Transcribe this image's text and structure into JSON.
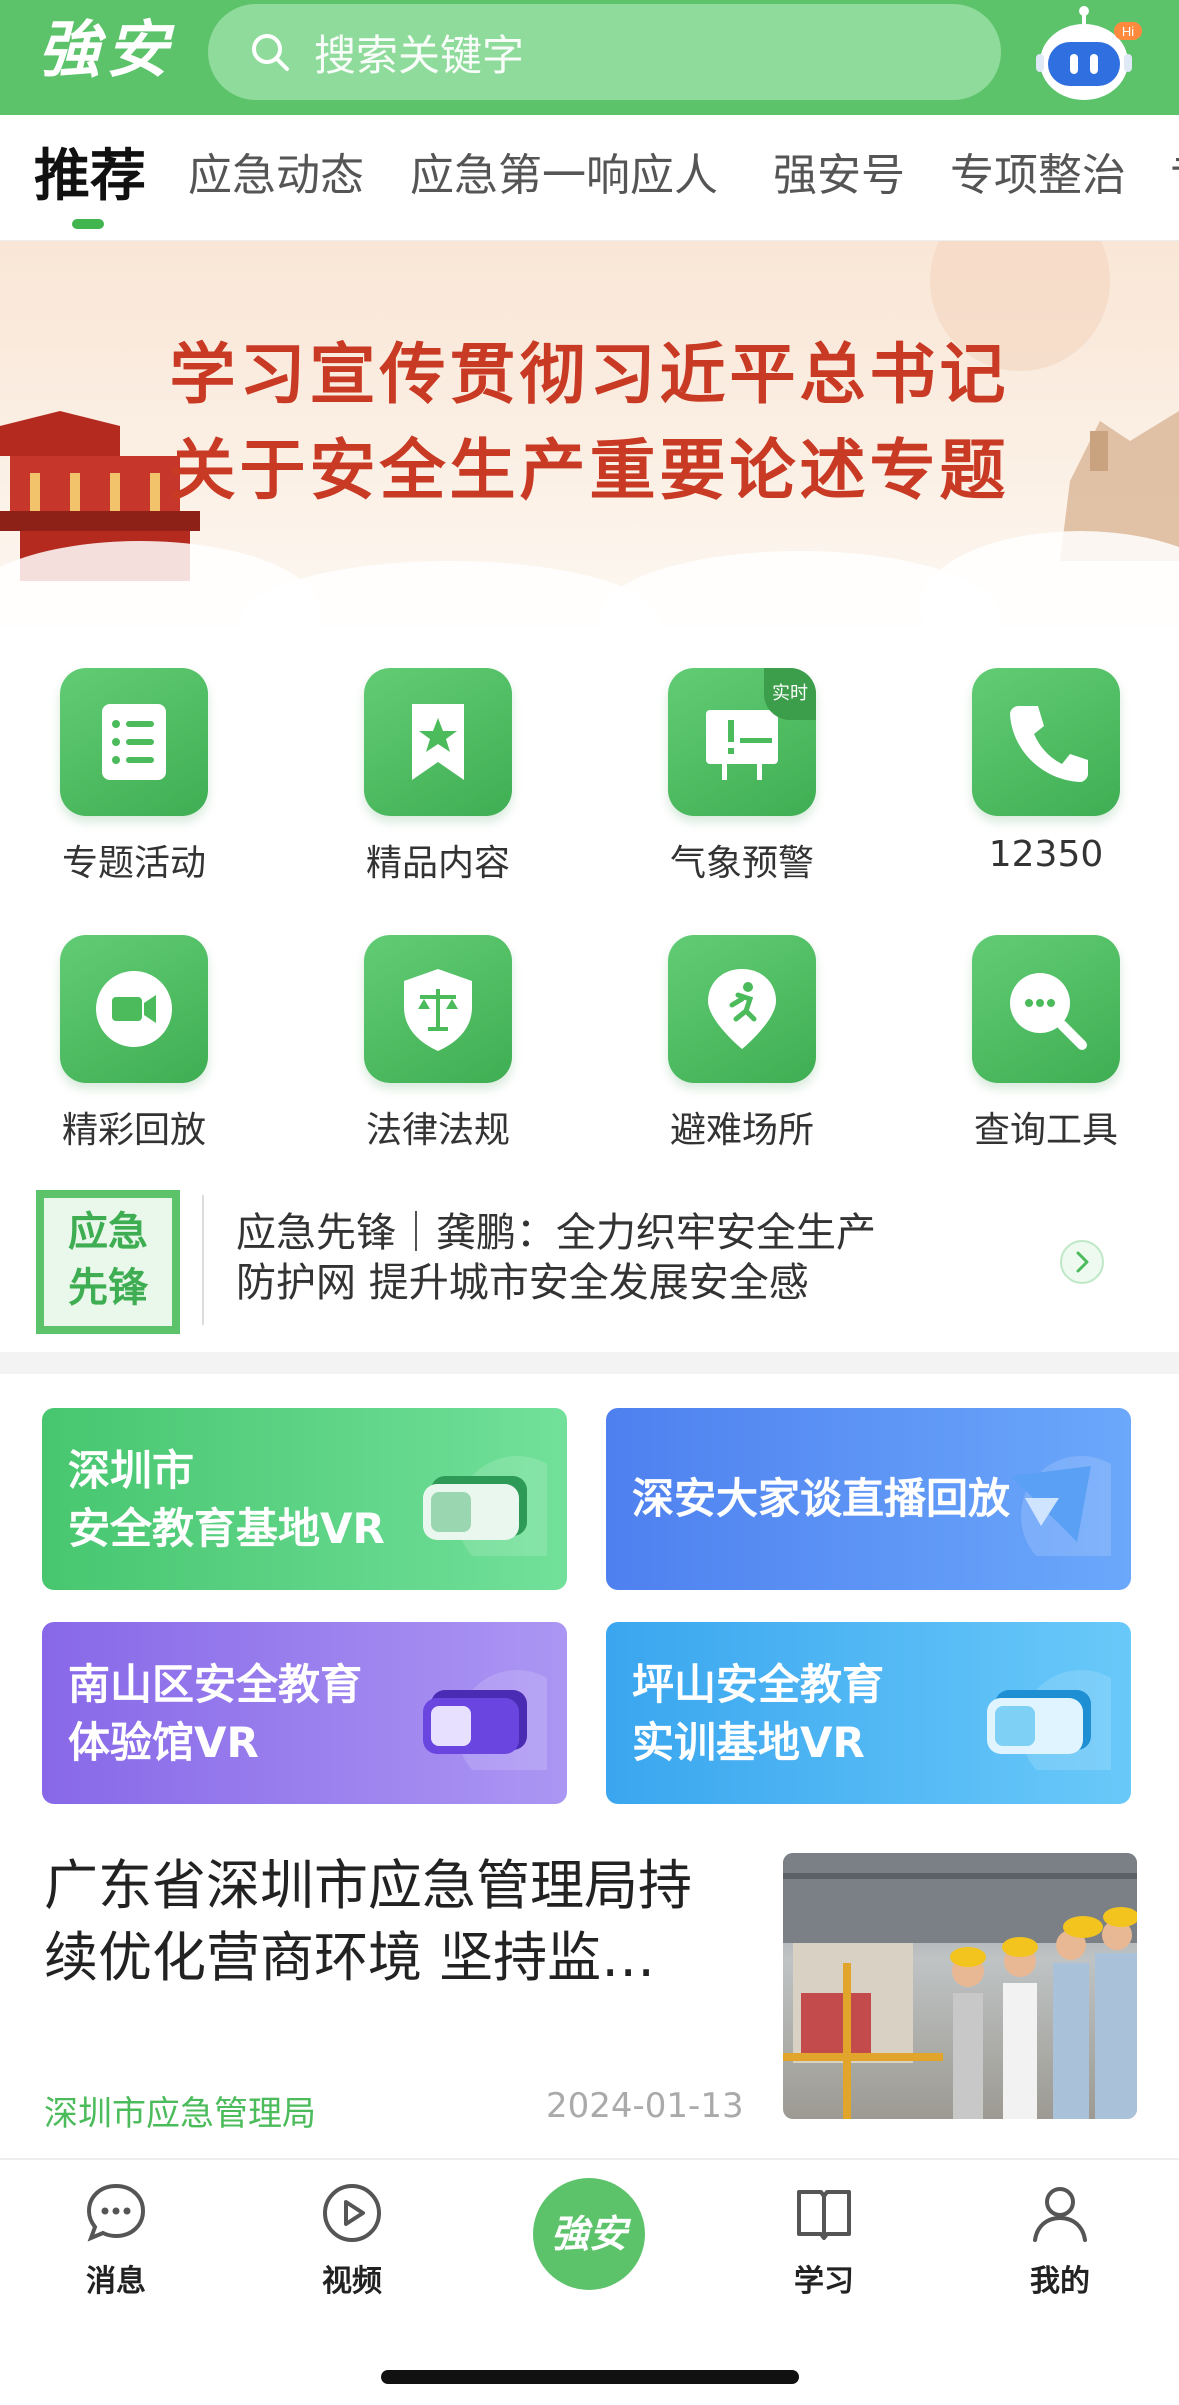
{
  "header": {
    "logo": "強安",
    "search_placeholder": "搜索关键字",
    "robot_badge": "Hi"
  },
  "tabs": [
    "推荐",
    "应急动态",
    "应急第一响应人",
    "强安号",
    "专项整治",
    "专"
  ],
  "banner": {
    "line1": "学习宣传贯彻习近平总书记",
    "line2": "关于安全生产重要论述专题"
  },
  "grid": [
    {
      "label": "专题活动",
      "icon": "list-doc-icon"
    },
    {
      "label": "精品内容",
      "icon": "bookmark-star-icon"
    },
    {
      "label": "气象预警",
      "icon": "warning-board-icon",
      "badge": "实时"
    },
    {
      "label": "12350",
      "icon": "phone-icon"
    },
    {
      "label": "精彩回放",
      "icon": "video-camera-icon"
    },
    {
      "label": "法律法规",
      "icon": "shield-scale-icon"
    },
    {
      "label": "避难场所",
      "icon": "location-run-icon"
    },
    {
      "label": "查询工具",
      "icon": "search-chat-icon"
    }
  ],
  "ticker": {
    "badge_line1": "应急",
    "badge_line2": "先锋",
    "text_line1": "应急先锋｜龚鹏：全力织牢安全生产",
    "text_line2": "防护网 提升城市安全发展安全感"
  },
  "cards": [
    {
      "line1": "深圳市",
      "line2": "安全教育基地VR",
      "color_from": "#4fce79",
      "color_to": "#6fe39a"
    },
    {
      "line1": "深安大家谈直播回放",
      "line2": "",
      "color_from": "#4d7ff0",
      "color_to": "#6aa5fa"
    },
    {
      "line1": "南山区安全教育",
      "line2": "体验馆VR",
      "color_from": "#8a6ee8",
      "color_to": "#a993f2"
    },
    {
      "line1": "坪山安全教育",
      "line2": "实训基地VR",
      "color_from": "#3da9f0",
      "color_to": "#66c6f8"
    }
  ],
  "article": {
    "title_line1": "广东省深圳市应急管理局持",
    "title_line2": "续优化营商环境 坚持监…",
    "source": "深圳市应急管理局",
    "date": "2024-01-13"
  },
  "bottom_nav": {
    "messages": "消息",
    "video": "视频",
    "center": "強安",
    "study": "学习",
    "mine": "我的"
  }
}
